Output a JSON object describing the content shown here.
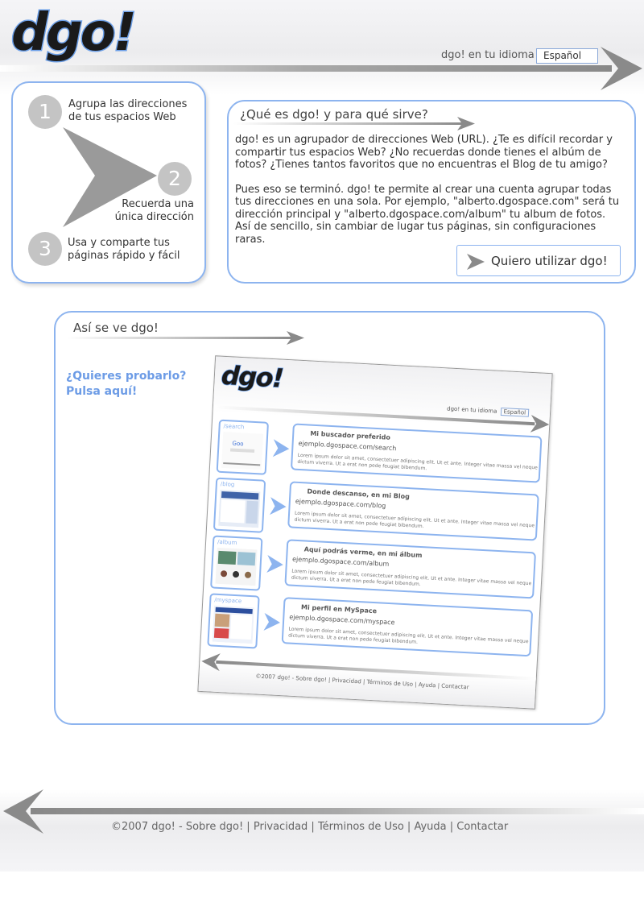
{
  "header": {
    "logo_text": "dgo!",
    "language_label": "dgo! en tu idioma",
    "language_value": "Español"
  },
  "steps": [
    {
      "number": "1",
      "text_line1": "Agrupa las direcciones",
      "text_line2": "de tus espacios Web"
    },
    {
      "number": "2",
      "text_line1": "Recuerda una",
      "text_line2": "única dirección"
    },
    {
      "number": "3",
      "text_line1": "Usa y comparte tus",
      "text_line2": "páginas rápido y fácil"
    }
  ],
  "about": {
    "title": "¿Qué es dgo! y para qué sirve?",
    "paragraph1": "dgo! es un agrupador de direcciones Web (URL). ¿Te es difícil recordar y compartir tus espacios Web? ¿No recuerdas donde tienes el albúm de fotos? ¿Tienes tantos favoritos que no encuentras el Blog de tu amigo?",
    "paragraph2": "Pues eso se terminó. dgo! te permite al crear una cuenta agrupar todas tus direcciones en una sola. Por ejemplo, \"alberto.dgospace.com\" será tu dirección principal y \"alberto.dgospace.com/album\" tu album de fotos. Así de sencillo, sin cambiar de lugar tus páginas, sin configuraciones raras.",
    "cta_label": "Quiero utilizar dgo!"
  },
  "preview": {
    "title": "Así se ve dgo!",
    "try_line1": "¿Quieres probarlo?",
    "try_line2": "Pulsa aquí!",
    "screenshot": {
      "logo_text": "dgo!",
      "language_label": "dgo! en tu idioma",
      "language_value": "Español",
      "rows": [
        {
          "thumb_label": "/search",
          "title": "Mi buscador preferido",
          "url": "ejemplo.dgospace.com/search",
          "desc": "Lorem ipsum dolor sit amet, consectetuer adipiscing elit. Ut et ante. Integer vitae massa vel neque dictum viverra. Ut a erat non pede feugiat bibendum."
        },
        {
          "thumb_label": "/blog",
          "title": "Donde descanso, en mi Blog",
          "url": "ejemplo.dgospace.com/blog",
          "desc": "Lorem ipsum dolor sit amet, consectetuer adipiscing elit. Ut et ante. Integer vitae massa vel neque dictum viverra. Ut a erat non pede feugiat bibendum."
        },
        {
          "thumb_label": "/album",
          "title": "Aquí podrás verme, en mi álbum",
          "url": "ejemplo.dgospace.com/album",
          "desc": "Lorem ipsum dolor sit amet, consectetuer adipiscing elit. Ut et ante. Integer vitae massa vel neque dictum viverra. Ut a erat non pede feugiat bibendum."
        },
        {
          "thumb_label": "/myspace",
          "title": "Mi perfil en MySpace",
          "url": "ejemplo.dgospace.com/myspace",
          "desc": "Lorem ipsum dolor sit amet, consectetuer adipiscing elit. Ut et ante. Integer vitae massa vel neque dictum viverra. Ut a erat non pede feugiat bibendum."
        }
      ],
      "footer_text": "©2007 dgo! - Sobre dgo! | Privacidad  | Términos de Uso  | Ayuda  | Contactar"
    }
  },
  "footer": {
    "copyright": "©2007 dgo! - ",
    "about": "Sobre dgo!",
    "sep1": " | ",
    "privacy": "Privacidad",
    "sep2": "  | ",
    "terms": "Términos de Uso",
    "sep3": "  | ",
    "help": "Ayuda",
    "sep4": "  | ",
    "contact": "Contactar"
  },
  "colors": {
    "accent_blue": "#8db4ef",
    "link_blue": "#6d9ce6",
    "arrow_gray": "#8a8a8a",
    "step_circle": "#c4c4c4"
  }
}
